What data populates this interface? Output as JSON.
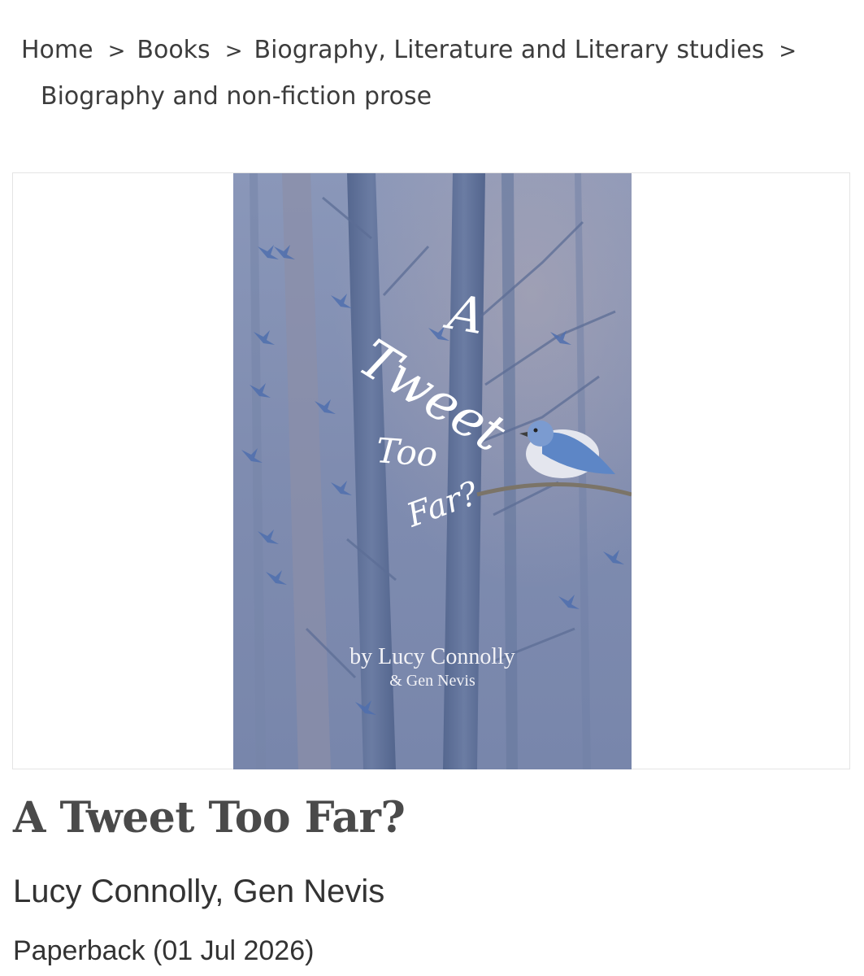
{
  "breadcrumb": {
    "items": [
      {
        "label": "Home"
      },
      {
        "label": "Books"
      },
      {
        "label": "Biography, Literature and Literary studies"
      },
      {
        "label": "Biography and non-fiction prose"
      }
    ],
    "separator": ">"
  },
  "cover": {
    "title_line1": "A",
    "title_line2": "Tweet",
    "title_line3": "Too",
    "title_line4": "Far?",
    "byline": "by Lucy Connolly",
    "coauthor": "& Gen Nevis",
    "background_color": "#7f8fb3",
    "bird_color": "#6f8fc4"
  },
  "product": {
    "title": "A Tweet Too Far?",
    "authors": "Lucy Connolly, Gen Nevis",
    "format": "Paperback (01 Jul 2026)"
  }
}
